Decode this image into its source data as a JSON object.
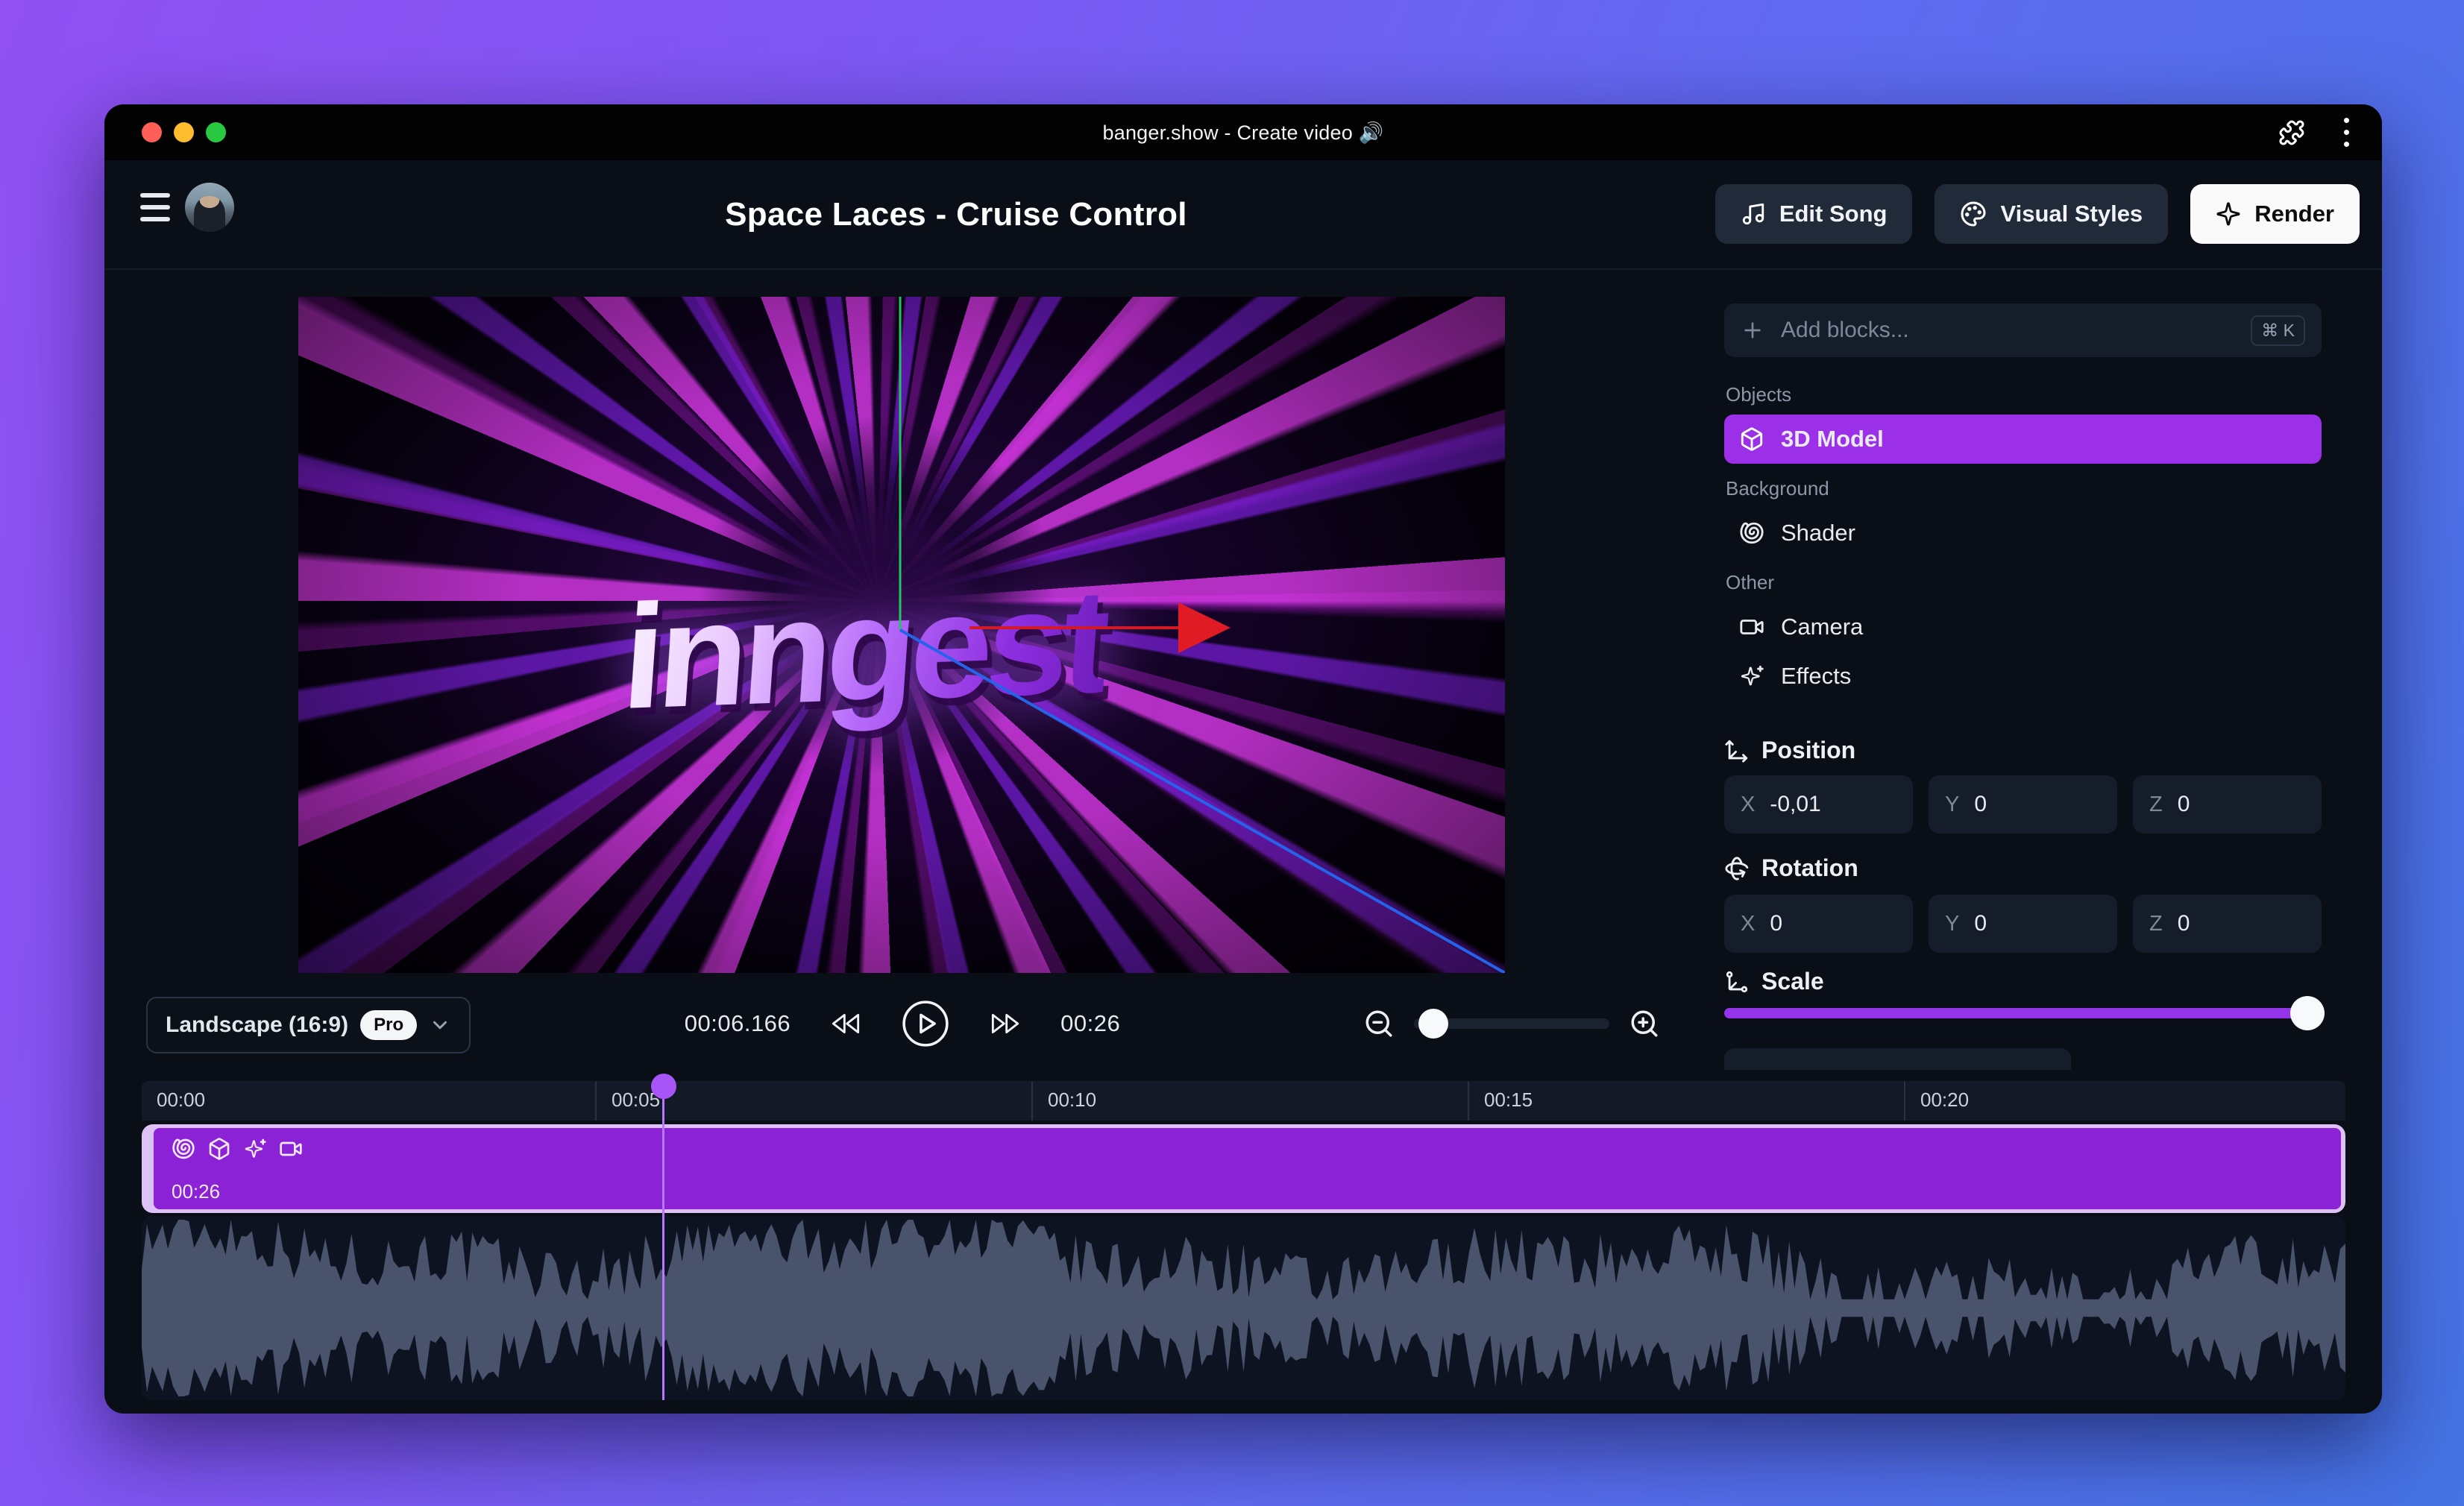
{
  "window": {
    "title": "banger.show - Create video 🔊"
  },
  "header": {
    "project_title": "Space Laces - Cruise Control",
    "edit_song_label": "Edit Song",
    "visual_styles_label": "Visual Styles",
    "render_label": "Render"
  },
  "preview": {
    "logo_text": "inngest"
  },
  "controls": {
    "aspect_label": "Landscape (16:9)",
    "pro_badge": "Pro",
    "current_time": "00:06.166",
    "total_duration": "00:26"
  },
  "sidebar": {
    "add_blocks": {
      "placeholder": "Add blocks...",
      "shortcut": "⌘ K"
    },
    "groups": [
      {
        "label": "Objects",
        "items": [
          {
            "label": "3D Model",
            "icon": "box-icon",
            "selected": true
          }
        ]
      },
      {
        "label": "Background",
        "items": [
          {
            "label": "Shader",
            "icon": "shell-icon"
          }
        ]
      },
      {
        "label": "Other",
        "items": [
          {
            "label": "Camera",
            "icon": "video-icon"
          },
          {
            "label": "Effects",
            "icon": "sparkles-icon"
          }
        ]
      }
    ],
    "axis": {
      "x": "X",
      "y": "Y",
      "z": "Z"
    },
    "properties": {
      "position": {
        "label": "Position",
        "x": "-0,01",
        "y": "0",
        "z": "0"
      },
      "rotation": {
        "label": "Rotation",
        "x": "0",
        "y": "0",
        "z": "0"
      },
      "scale": {
        "label": "Scale",
        "percent": 100
      }
    }
  },
  "timeline": {
    "ruler": [
      "00:00",
      "00:05",
      "00:10",
      "00:15",
      "00:20"
    ],
    "clip": {
      "duration_label": "00:26"
    }
  },
  "colors": {
    "accent_purple": "#9b30e8",
    "clip_purple": "#8b22d6",
    "clip_border": "#ddc2f8",
    "playhead": "#a855f7",
    "waveform": "#49536b",
    "scale_slider": "#9333ea",
    "render_button_bg": "#fafafa",
    "traffic_red": "#ff5f57",
    "traffic_yellow": "#febc2e",
    "traffic_green": "#28c840",
    "gizmo_green": "#22c55e",
    "gizmo_blue": "#2563eb",
    "gizmo_red": "#e01b24"
  }
}
